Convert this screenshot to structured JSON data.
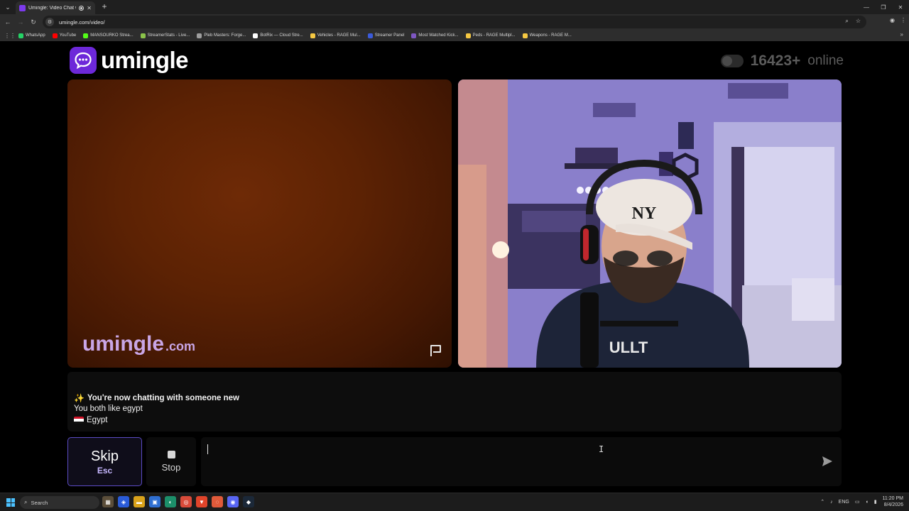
{
  "browser": {
    "tab_title": "Umingle: Video Chat with S",
    "tab_close": "✕",
    "new_tab": "+",
    "url": "umingle.com/video/",
    "bookmarks": [
      {
        "label": "WhatsApp",
        "color": "#25d366"
      },
      {
        "label": "YouTube",
        "color": "#ff0000"
      },
      {
        "label": "MANSOURKO Strea...",
        "color": "#53fc18"
      },
      {
        "label": "StreamerStats - Live...",
        "color": "#8bc34a"
      },
      {
        "label": "Pleb Masters: Forge...",
        "color": "#9e9e9e"
      },
      {
        "label": "BotRix — Cloud Stre...",
        "color": "#ffffff"
      },
      {
        "label": "Vehicles - RAGE Mul...",
        "color": "#f5c842"
      },
      {
        "label": "Streamer Panel",
        "color": "#3b5bdb"
      },
      {
        "label": "Most Watched Kick...",
        "color": "#7e57c2"
      },
      {
        "label": "Peds - RAGE Multipl...",
        "color": "#f5c842"
      },
      {
        "label": "Weapons - RAGE M...",
        "color": "#f5c842"
      }
    ],
    "bookmarks_more": "»"
  },
  "site": {
    "logo_text": "umingle",
    "online_count": "16423+",
    "online_label": "online",
    "watermark_main": "umingle",
    "watermark_tld": ".com",
    "brand_color": "#6d28d9"
  },
  "chat": {
    "messages": [
      {
        "icon": "✨",
        "text": "You're now chatting with someone new"
      },
      {
        "text": "You both like egypt"
      },
      {
        "text": "Egypt"
      }
    ]
  },
  "controls": {
    "skip_label": "Skip",
    "skip_key": "Esc",
    "stop_label": "Stop",
    "message_value": ""
  },
  "taskbar": {
    "search_label": "Search",
    "language": "ENG",
    "time": "11:20 PM",
    "date": "8/4/2026"
  }
}
